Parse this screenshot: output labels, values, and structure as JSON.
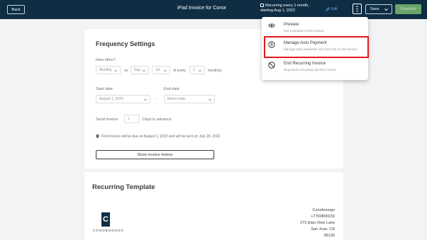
{
  "header": {
    "back_label": "Back",
    "title": "iPad Invoice for Conor",
    "recurring_line1": "Recurring every 1 month,",
    "recurring_line2": "starting Aug 1, 2022",
    "edit_label": "Edit",
    "save_label": "Save",
    "schedule_label": "Schedule"
  },
  "menu": {
    "items": [
      {
        "icon": "eye-icon",
        "title": "Preview",
        "desc": "Get a preview of this invoice"
      },
      {
        "icon": "dollar-circle-icon",
        "title": "Manage Auto Payment",
        "desc": "Manage auto payments and card info on this invoice"
      },
      {
        "icon": "no-entry-icon",
        "title": "End Recurring Invoice",
        "desc": "Stop future recurring and this invoice"
      }
    ]
  },
  "frequency": {
    "title": "Frequency Settings",
    "how_often_label": "How often?",
    "how_often_select": "Monthly",
    "on_label": "on",
    "day_select": "Day",
    "day_num_select": "1st",
    "of_every_label": "of every",
    "months_select": "1",
    "months_label": "month(s)",
    "start_label": "Start date",
    "start_value": "August 1, 2022",
    "dash": "-",
    "end_label": "End date",
    "end_value": "Never ends",
    "send_label": "Send invoice",
    "send_value": "1",
    "days_label": "Days in advance",
    "note": "First invoice will be due on August 1, 2022 and will be sent on July 29, 2022",
    "history_button": "Show invoice history"
  },
  "template": {
    "title": "Recurring Template",
    "logo_letter": "C",
    "logo_word": "CONOBOONGO",
    "address": [
      "Conoboongo",
      "+7700800233",
      "272 Elan View Lane",
      "San Jose, CA",
      "95135"
    ]
  },
  "colors": {
    "topbar": "#0f2e44",
    "schedule_button": "#6aa56c",
    "highlight": "#e21b1b"
  }
}
